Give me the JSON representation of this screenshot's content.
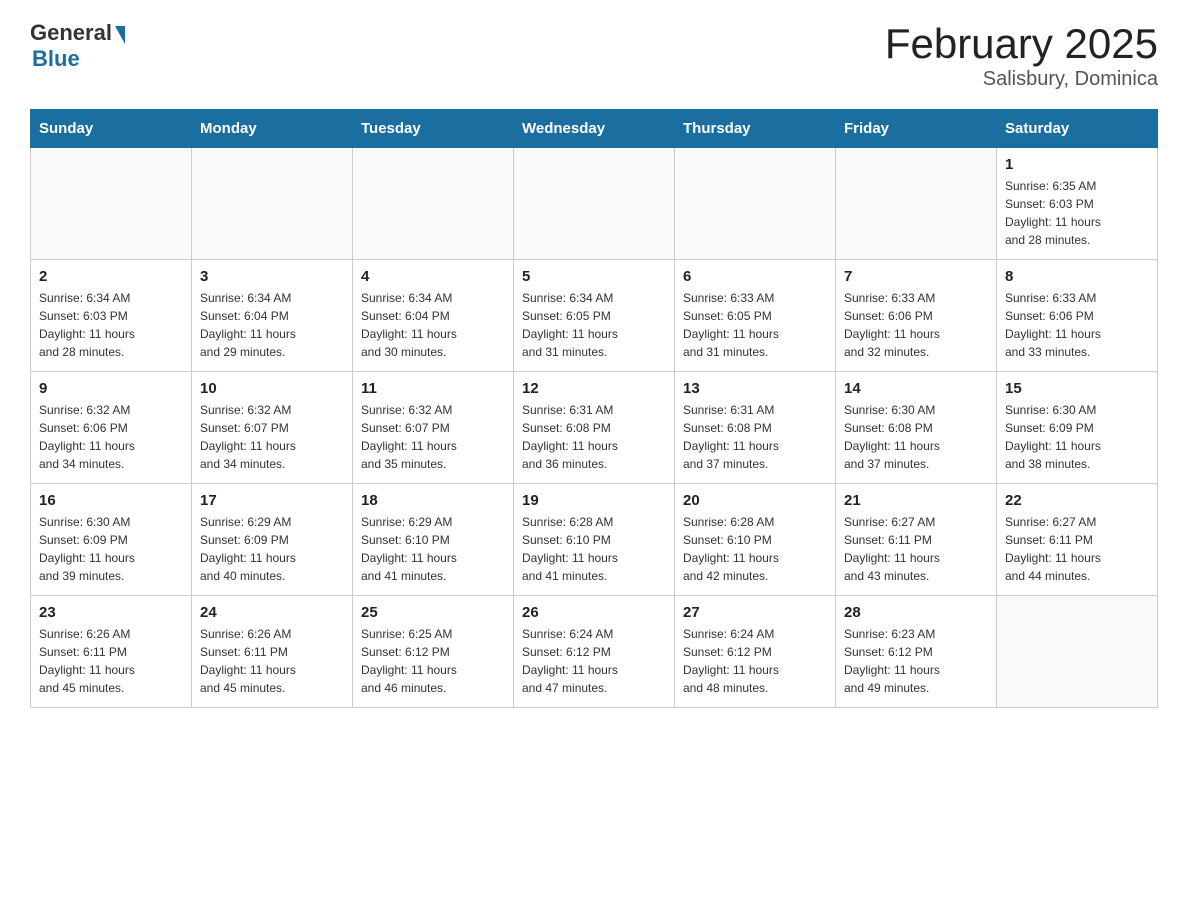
{
  "logo": {
    "general": "General",
    "blue": "Blue"
  },
  "title": "February 2025",
  "subtitle": "Salisbury, Dominica",
  "days_of_week": [
    "Sunday",
    "Monday",
    "Tuesday",
    "Wednesday",
    "Thursday",
    "Friday",
    "Saturday"
  ],
  "weeks": [
    [
      {
        "day": "",
        "info": ""
      },
      {
        "day": "",
        "info": ""
      },
      {
        "day": "",
        "info": ""
      },
      {
        "day": "",
        "info": ""
      },
      {
        "day": "",
        "info": ""
      },
      {
        "day": "",
        "info": ""
      },
      {
        "day": "1",
        "info": "Sunrise: 6:35 AM\nSunset: 6:03 PM\nDaylight: 11 hours\nand 28 minutes."
      }
    ],
    [
      {
        "day": "2",
        "info": "Sunrise: 6:34 AM\nSunset: 6:03 PM\nDaylight: 11 hours\nand 28 minutes."
      },
      {
        "day": "3",
        "info": "Sunrise: 6:34 AM\nSunset: 6:04 PM\nDaylight: 11 hours\nand 29 minutes."
      },
      {
        "day": "4",
        "info": "Sunrise: 6:34 AM\nSunset: 6:04 PM\nDaylight: 11 hours\nand 30 minutes."
      },
      {
        "day": "5",
        "info": "Sunrise: 6:34 AM\nSunset: 6:05 PM\nDaylight: 11 hours\nand 31 minutes."
      },
      {
        "day": "6",
        "info": "Sunrise: 6:33 AM\nSunset: 6:05 PM\nDaylight: 11 hours\nand 31 minutes."
      },
      {
        "day": "7",
        "info": "Sunrise: 6:33 AM\nSunset: 6:06 PM\nDaylight: 11 hours\nand 32 minutes."
      },
      {
        "day": "8",
        "info": "Sunrise: 6:33 AM\nSunset: 6:06 PM\nDaylight: 11 hours\nand 33 minutes."
      }
    ],
    [
      {
        "day": "9",
        "info": "Sunrise: 6:32 AM\nSunset: 6:06 PM\nDaylight: 11 hours\nand 34 minutes."
      },
      {
        "day": "10",
        "info": "Sunrise: 6:32 AM\nSunset: 6:07 PM\nDaylight: 11 hours\nand 34 minutes."
      },
      {
        "day": "11",
        "info": "Sunrise: 6:32 AM\nSunset: 6:07 PM\nDaylight: 11 hours\nand 35 minutes."
      },
      {
        "day": "12",
        "info": "Sunrise: 6:31 AM\nSunset: 6:08 PM\nDaylight: 11 hours\nand 36 minutes."
      },
      {
        "day": "13",
        "info": "Sunrise: 6:31 AM\nSunset: 6:08 PM\nDaylight: 11 hours\nand 37 minutes."
      },
      {
        "day": "14",
        "info": "Sunrise: 6:30 AM\nSunset: 6:08 PM\nDaylight: 11 hours\nand 37 minutes."
      },
      {
        "day": "15",
        "info": "Sunrise: 6:30 AM\nSunset: 6:09 PM\nDaylight: 11 hours\nand 38 minutes."
      }
    ],
    [
      {
        "day": "16",
        "info": "Sunrise: 6:30 AM\nSunset: 6:09 PM\nDaylight: 11 hours\nand 39 minutes."
      },
      {
        "day": "17",
        "info": "Sunrise: 6:29 AM\nSunset: 6:09 PM\nDaylight: 11 hours\nand 40 minutes."
      },
      {
        "day": "18",
        "info": "Sunrise: 6:29 AM\nSunset: 6:10 PM\nDaylight: 11 hours\nand 41 minutes."
      },
      {
        "day": "19",
        "info": "Sunrise: 6:28 AM\nSunset: 6:10 PM\nDaylight: 11 hours\nand 41 minutes."
      },
      {
        "day": "20",
        "info": "Sunrise: 6:28 AM\nSunset: 6:10 PM\nDaylight: 11 hours\nand 42 minutes."
      },
      {
        "day": "21",
        "info": "Sunrise: 6:27 AM\nSunset: 6:11 PM\nDaylight: 11 hours\nand 43 minutes."
      },
      {
        "day": "22",
        "info": "Sunrise: 6:27 AM\nSunset: 6:11 PM\nDaylight: 11 hours\nand 44 minutes."
      }
    ],
    [
      {
        "day": "23",
        "info": "Sunrise: 6:26 AM\nSunset: 6:11 PM\nDaylight: 11 hours\nand 45 minutes."
      },
      {
        "day": "24",
        "info": "Sunrise: 6:26 AM\nSunset: 6:11 PM\nDaylight: 11 hours\nand 45 minutes."
      },
      {
        "day": "25",
        "info": "Sunrise: 6:25 AM\nSunset: 6:12 PM\nDaylight: 11 hours\nand 46 minutes."
      },
      {
        "day": "26",
        "info": "Sunrise: 6:24 AM\nSunset: 6:12 PM\nDaylight: 11 hours\nand 47 minutes."
      },
      {
        "day": "27",
        "info": "Sunrise: 6:24 AM\nSunset: 6:12 PM\nDaylight: 11 hours\nand 48 minutes."
      },
      {
        "day": "28",
        "info": "Sunrise: 6:23 AM\nSunset: 6:12 PM\nDaylight: 11 hours\nand 49 minutes."
      },
      {
        "day": "",
        "info": ""
      }
    ]
  ]
}
